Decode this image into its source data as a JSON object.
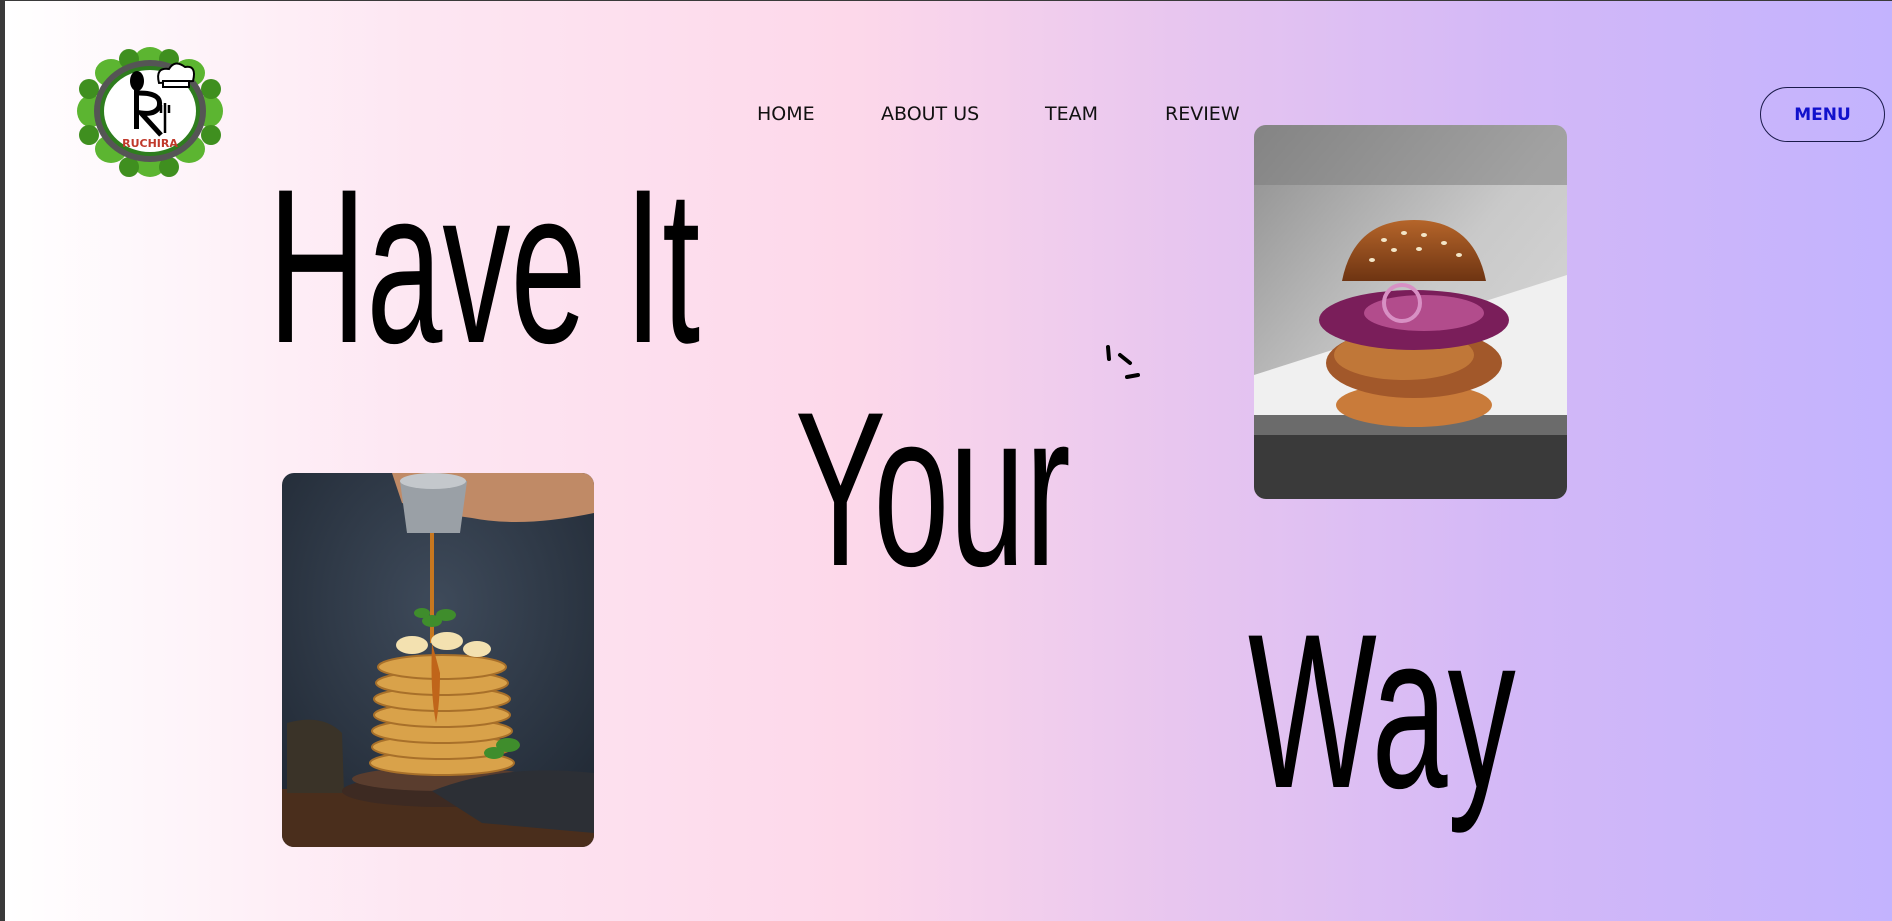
{
  "brand": {
    "logo_text": "RUCHIRA"
  },
  "nav": {
    "items": [
      {
        "label": "HOME"
      },
      {
        "label": "ABOUT US"
      },
      {
        "label": "TEAM"
      },
      {
        "label": "REVIEW"
      }
    ],
    "menu_button": "MENU"
  },
  "hero": {
    "line1": "Have It",
    "line2": "Your",
    "line3": "Way"
  },
  "images": {
    "burger": "burger-photo",
    "pancakes": "pancake-stack-photo"
  },
  "colors": {
    "gradient_start": "#ffffff",
    "gradient_mid": "#fdd8ea",
    "gradient_end": "#c3b3fe",
    "menu_text": "#1111cc",
    "logo_leaf": "#5cb531"
  }
}
